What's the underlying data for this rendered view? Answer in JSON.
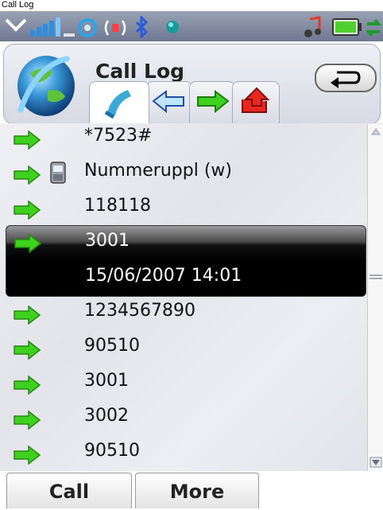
{
  "caption": "Call Log",
  "status_bar": {
    "icons": [
      "menu-arrow-icon",
      "signal-strength-icon",
      "gprs-icon",
      "wifi-icon",
      "bluetooth-icon",
      "status-dot-icon",
      "music-note-icon",
      "battery-icon",
      "sync-icon"
    ]
  },
  "header": {
    "title": "Call Log",
    "logo": "globe-logo",
    "back_icon": "back-arrow-icon",
    "tabs": [
      {
        "icon": "phone-handset-icon",
        "active": true
      },
      {
        "icon": "blue-left-arrow-icon",
        "active": false
      },
      {
        "icon": "green-right-arrow-icon",
        "active": false
      },
      {
        "icon": "red-missed-arrow-icon",
        "active": false
      }
    ]
  },
  "call_list": {
    "items": [
      {
        "label": "*7523#"
      },
      {
        "label": "Nummeruppl (w)",
        "has_phone_icon": true
      },
      {
        "label": "118118"
      },
      {
        "label": "3001",
        "selected": true,
        "detail": "15/06/2007 14:01"
      },
      {
        "label": "1234567890"
      },
      {
        "label": "90510"
      },
      {
        "label": "3001"
      },
      {
        "label": "3002"
      },
      {
        "label": "90510"
      }
    ]
  },
  "softkeys": {
    "left": "Call",
    "right": "More"
  },
  "colors": {
    "arrow_green": "#3fd11f",
    "status_bar": "#7d859c",
    "selection": "#000000"
  }
}
